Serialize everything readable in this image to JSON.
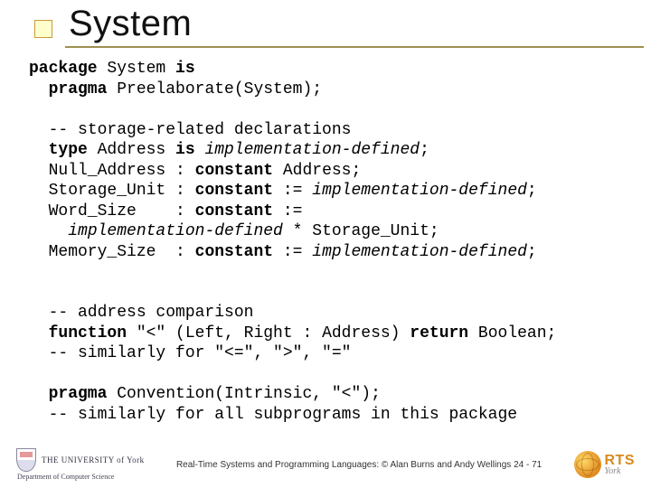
{
  "title": "System",
  "code": {
    "l1a": "package",
    "l1b": " System ",
    "l1c": "is",
    "l2a": "  pragma",
    "l2b": " Preelaborate(System);",
    "l3": "",
    "l4a": "  -- ",
    "l4b": "storage-related declarations",
    "l5a": "  type",
    "l5b": " Address ",
    "l5c": "is",
    "l5d": " implementation-defined",
    "l5e": ";",
    "l6a": "  Null_Address : ",
    "l6b": "constant",
    "l6c": " Address;",
    "l7a": "  Storage_Unit : ",
    "l7b": "constant",
    "l7c": " := ",
    "l7d": "implementation-defined",
    "l7e": ";",
    "l8a": "  Word_Size    : ",
    "l8b": "constant",
    "l8c": " :=",
    "l9a": "    ",
    "l9b": "implementation-defined",
    "l9c": " * Storage_Unit;",
    "l10a": "  Memory_Size  : ",
    "l10b": "constant",
    "l10c": " := ",
    "l10d": "implementation-defined",
    "l10e": ";",
    "l11": "",
    "l12": "",
    "l13a": "  -- address comparison",
    "l14a": "  function",
    "l14b": " \"<\" (Left, Right : Address) ",
    "l14c": "return",
    "l14d": " Boolean;",
    "l15": "  -- similarly for \"<=\", \">\", \"=\"",
    "l16": "",
    "l17a": "  pragma",
    "l17b": " Convention(Intrinsic, \"<\");",
    "l18": "  -- similarly for all subprograms in this package"
  },
  "footer": {
    "uni_line1": "THE UNIVERSITY of York",
    "uni_line2": "Department of Computer Science",
    "center": "Real-Time Systems and Programming Languages: © Alan Burns and Andy Wellings 24 - 71",
    "rts_main": "RTS",
    "rts_sub": "York"
  }
}
